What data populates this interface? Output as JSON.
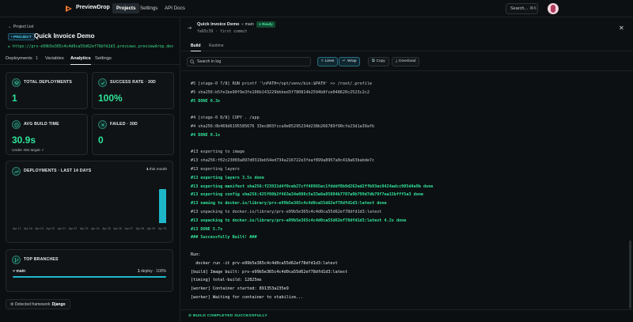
{
  "app": {
    "name": "PreviewDrop"
  },
  "nav": {
    "projects": "Projects",
    "settings": "Settings",
    "api_docs": "API Docs"
  },
  "search": {
    "label": "Search...",
    "shortcut": "⌘K"
  },
  "project": {
    "back_label": "Project List",
    "badge": "PROJECT",
    "title": "Quick Invoice Demo",
    "url": "https://prv-e99b5e365c4c4d0ca55d62ef78dfd1d3.previews.previewdrop.dev"
  },
  "tabs": [
    {
      "label": "Deployments",
      "count": "1"
    },
    {
      "label": "Variables"
    },
    {
      "label": "Analytics"
    },
    {
      "label": "Settings"
    }
  ],
  "stats": {
    "total": {
      "label": "TOTAL DEPLOYMENTS",
      "value": "1"
    },
    "success": {
      "label": "SUCCESS RATE · 30D",
      "value": "100%"
    },
    "avg_build": {
      "label": "AVG BUILD TIME",
      "value": "30.9s",
      "sub": "Under 45s target ✓"
    },
    "failed": {
      "label": "FAILED · 30D",
      "value": "0"
    }
  },
  "chart_data": {
    "type": "bar",
    "title": "DEPLOYMENTS · LAST 14 DAYS",
    "total_label": "this month",
    "total_value": "1",
    "categories": [
      "Apr 17",
      "Apr 18",
      "Apr 19",
      "Apr 20",
      "Apr 21",
      "Apr 22",
      "Apr 23",
      "Apr 24",
      "Apr 25",
      "Apr 26",
      "Apr 27",
      "Apr 28",
      "Apr 29",
      "Apr 30"
    ],
    "values": [
      0,
      0,
      0,
      0,
      0,
      0,
      0,
      0,
      0,
      0,
      0,
      0,
      0,
      1
    ],
    "ylim": [
      0,
      1
    ],
    "color": "#1db7c9"
  },
  "branches": {
    "title": "TOP BRANCHES",
    "items": [
      {
        "name": "main",
        "count": "1",
        "stat": "deploy · 100%",
        "fraction": 1.0
      }
    ]
  },
  "framework": {
    "label": "Detected framework",
    "value": "Django"
  },
  "run": {
    "title": "Quick Invoice Demo",
    "branch": "main",
    "status": "Ready",
    "commit": "fa93c39",
    "commit_message": "first commit"
  },
  "subtabs": [
    "Build",
    "Runtime"
  ],
  "toolbar": {
    "search_placeholder": "Search in log",
    "lines": "Lines",
    "wrap": "Wrap",
    "copy": "Copy",
    "download": "Download"
  },
  "log_lines": [
    {
      "text": "#5 [stage-0 7/8] RUN printf '\\nPATH=/opt/venv/bin:$PATH' >> /root/.profile",
      "style": "norm"
    },
    {
      "text": "#5 sha256:b5fe1be90f9e3fe106b143229bbbed3f780814b2594b8fce048620c2523c2c2",
      "style": "norm"
    },
    {
      "text": "#5 DONE 0.3s",
      "style": "green"
    },
    {
      "text": "",
      "style": "norm"
    },
    {
      "text": "#4 [stage-0 8/8] COPY . /app",
      "style": "norm"
    },
    {
      "text": "#4 sha256:0b469d6195585676 33ec803fcca9e85295234d238b266789f90cfe23d1a39afb",
      "style": "norm"
    },
    {
      "text": "#4 DONE 0.1s",
      "style": "green"
    },
    {
      "text": "",
      "style": "norm"
    },
    {
      "text": "#13 exporting to image",
      "style": "norm"
    },
    {
      "text": "#13 sha256:f02c23003a897d0319eb54ed734a216722e3feaf899a8957a0c418a63babde7c",
      "style": "norm"
    },
    {
      "text": "#13 exporting layers",
      "style": "norm"
    },
    {
      "text": "#13 exporting layers 3.5s done",
      "style": "green"
    },
    {
      "text": "#13 exporting manifest sha256:f23931d4f0ceb27cff48965ec1fdddf8b9d262ed2ffb93ec0424adcc905d4e9b done",
      "style": "green"
    },
    {
      "text": "#13 exporting config sha256:425f08b2f463a34e008c5e33a6e85804b7707a9b799d7db79f7ea15bfff5a3 done",
      "style": "green"
    },
    {
      "text": "#13 naming to docker.io/library/prv-e99b5e365c4c4d0ca55d62ef78dfd1d3:latest done",
      "style": "green"
    },
    {
      "text": "#13 unpacking to docker.io/library/prv-e99b5e365c4c4d0ca55d62ef78dfd1d3:latest",
      "style": "norm"
    },
    {
      "text": "#13 unpacking to docker.io/library/prv-e99b5e365c4c4d0ca55d62ef78dfd1d3:latest 4.2s done",
      "style": "green"
    },
    {
      "text": "#13 DONE 5.7s",
      "style": "green"
    },
    {
      "text": "### Successfully Built! ###",
      "style": "green"
    },
    {
      "text": "",
      "style": "norm"
    },
    {
      "text": "Run:",
      "style": "white"
    },
    {
      "text": "  docker run -it prv-e99b5e365c4c4d0ca55d62ef78dfd1d3:latest",
      "style": "white"
    },
    {
      "text": "[build] Image built: prv-e99b5e365c4c4d0ca55d62ef78dfd1d3:latest",
      "style": "white"
    },
    {
      "text": "[timing] total-build: 12825ms",
      "style": "white"
    },
    {
      "text": "[worker] Container started: 891353a235e9",
      "style": "white"
    },
    {
      "text": "[worker] Waiting for container to stabilize...",
      "style": "white"
    }
  ],
  "status_bar": {
    "text": "BUILD COMPLETED SUCCESSFULLY"
  },
  "colors": {
    "accent": "#1db7c9",
    "success": "#2fe39a",
    "background": "#0b0e10"
  }
}
